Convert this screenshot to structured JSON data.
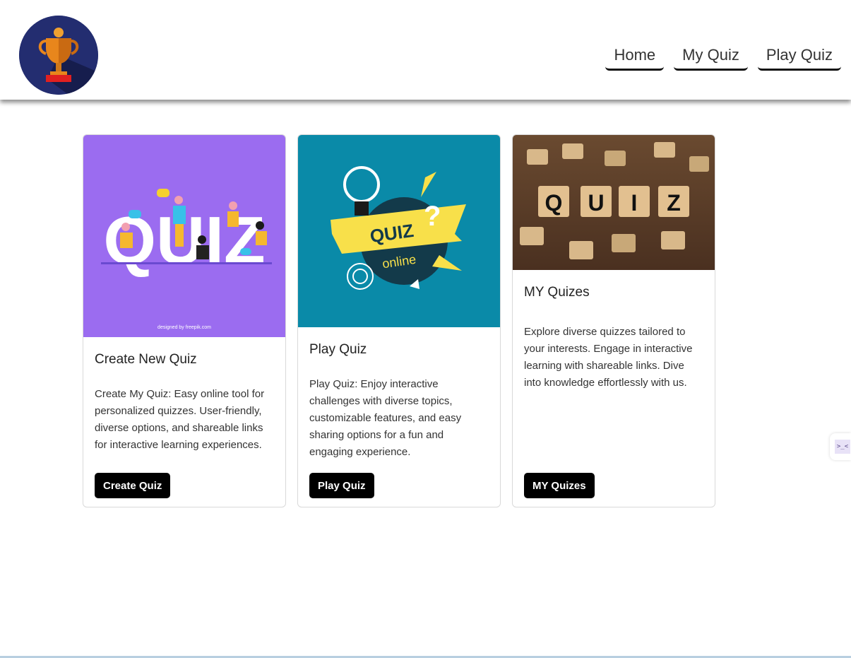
{
  "header": {
    "logo_icon": "trophy-icon",
    "nav": [
      {
        "label": "Home"
      },
      {
        "label": "My Quiz"
      },
      {
        "label": "Play Quiz"
      }
    ]
  },
  "cards": [
    {
      "title": "Create New Quiz",
      "text": "Create My Quiz: Easy online tool for personalized quizzes. User-friendly, diverse options, and shareable links for interactive learning experiences.",
      "button": "Create Quiz",
      "image_text": "QUIZ",
      "image_credit": "designed by freepik.com"
    },
    {
      "title": "Play Quiz",
      "text": "Play Quiz: Enjoy interactive challenges with diverse topics, customizable features, and easy sharing options for a fun and engaging experience.",
      "button": "Play Quiz",
      "image_text": "QUIZ",
      "image_subtext": "online"
    },
    {
      "title": "MY Quizes",
      "text": "Explore diverse quizzes tailored to your interests. Engage in interactive learning with shareable links. Dive into knowledge effortlessly with us.",
      "button": "MY Quizes",
      "image_letters": [
        "Q",
        "U",
        "I",
        "Z"
      ]
    }
  ],
  "side_widget": {
    "glyph": ">_<"
  },
  "colors": {
    "button_bg": "#000000",
    "card1_bg": "#9b6cf0",
    "card2_bg": "#0a8aa8",
    "logo_bg": "#1f2a6b",
    "trophy": "#e07b1a"
  }
}
